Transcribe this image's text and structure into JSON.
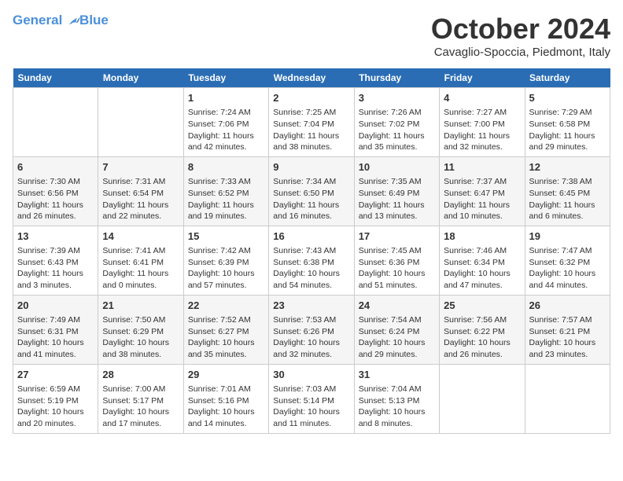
{
  "header": {
    "logo_line1": "General",
    "logo_line2": "Blue",
    "month": "October 2024",
    "location": "Cavaglio-Spoccia, Piedmont, Italy"
  },
  "weekdays": [
    "Sunday",
    "Monday",
    "Tuesday",
    "Wednesday",
    "Thursday",
    "Friday",
    "Saturday"
  ],
  "weeks": [
    [
      {
        "day": "",
        "info": ""
      },
      {
        "day": "",
        "info": ""
      },
      {
        "day": "1",
        "info": "Sunrise: 7:24 AM\nSunset: 7:06 PM\nDaylight: 11 hours and 42 minutes."
      },
      {
        "day": "2",
        "info": "Sunrise: 7:25 AM\nSunset: 7:04 PM\nDaylight: 11 hours and 38 minutes."
      },
      {
        "day": "3",
        "info": "Sunrise: 7:26 AM\nSunset: 7:02 PM\nDaylight: 11 hours and 35 minutes."
      },
      {
        "day": "4",
        "info": "Sunrise: 7:27 AM\nSunset: 7:00 PM\nDaylight: 11 hours and 32 minutes."
      },
      {
        "day": "5",
        "info": "Sunrise: 7:29 AM\nSunset: 6:58 PM\nDaylight: 11 hours and 29 minutes."
      }
    ],
    [
      {
        "day": "6",
        "info": "Sunrise: 7:30 AM\nSunset: 6:56 PM\nDaylight: 11 hours and 26 minutes."
      },
      {
        "day": "7",
        "info": "Sunrise: 7:31 AM\nSunset: 6:54 PM\nDaylight: 11 hours and 22 minutes."
      },
      {
        "day": "8",
        "info": "Sunrise: 7:33 AM\nSunset: 6:52 PM\nDaylight: 11 hours and 19 minutes."
      },
      {
        "day": "9",
        "info": "Sunrise: 7:34 AM\nSunset: 6:50 PM\nDaylight: 11 hours and 16 minutes."
      },
      {
        "day": "10",
        "info": "Sunrise: 7:35 AM\nSunset: 6:49 PM\nDaylight: 11 hours and 13 minutes."
      },
      {
        "day": "11",
        "info": "Sunrise: 7:37 AM\nSunset: 6:47 PM\nDaylight: 11 hours and 10 minutes."
      },
      {
        "day": "12",
        "info": "Sunrise: 7:38 AM\nSunset: 6:45 PM\nDaylight: 11 hours and 6 minutes."
      }
    ],
    [
      {
        "day": "13",
        "info": "Sunrise: 7:39 AM\nSunset: 6:43 PM\nDaylight: 11 hours and 3 minutes."
      },
      {
        "day": "14",
        "info": "Sunrise: 7:41 AM\nSunset: 6:41 PM\nDaylight: 11 hours and 0 minutes."
      },
      {
        "day": "15",
        "info": "Sunrise: 7:42 AM\nSunset: 6:39 PM\nDaylight: 10 hours and 57 minutes."
      },
      {
        "day": "16",
        "info": "Sunrise: 7:43 AM\nSunset: 6:38 PM\nDaylight: 10 hours and 54 minutes."
      },
      {
        "day": "17",
        "info": "Sunrise: 7:45 AM\nSunset: 6:36 PM\nDaylight: 10 hours and 51 minutes."
      },
      {
        "day": "18",
        "info": "Sunrise: 7:46 AM\nSunset: 6:34 PM\nDaylight: 10 hours and 47 minutes."
      },
      {
        "day": "19",
        "info": "Sunrise: 7:47 AM\nSunset: 6:32 PM\nDaylight: 10 hours and 44 minutes."
      }
    ],
    [
      {
        "day": "20",
        "info": "Sunrise: 7:49 AM\nSunset: 6:31 PM\nDaylight: 10 hours and 41 minutes."
      },
      {
        "day": "21",
        "info": "Sunrise: 7:50 AM\nSunset: 6:29 PM\nDaylight: 10 hours and 38 minutes."
      },
      {
        "day": "22",
        "info": "Sunrise: 7:52 AM\nSunset: 6:27 PM\nDaylight: 10 hours and 35 minutes."
      },
      {
        "day": "23",
        "info": "Sunrise: 7:53 AM\nSunset: 6:26 PM\nDaylight: 10 hours and 32 minutes."
      },
      {
        "day": "24",
        "info": "Sunrise: 7:54 AM\nSunset: 6:24 PM\nDaylight: 10 hours and 29 minutes."
      },
      {
        "day": "25",
        "info": "Sunrise: 7:56 AM\nSunset: 6:22 PM\nDaylight: 10 hours and 26 minutes."
      },
      {
        "day": "26",
        "info": "Sunrise: 7:57 AM\nSunset: 6:21 PM\nDaylight: 10 hours and 23 minutes."
      }
    ],
    [
      {
        "day": "27",
        "info": "Sunrise: 6:59 AM\nSunset: 5:19 PM\nDaylight: 10 hours and 20 minutes."
      },
      {
        "day": "28",
        "info": "Sunrise: 7:00 AM\nSunset: 5:17 PM\nDaylight: 10 hours and 17 minutes."
      },
      {
        "day": "29",
        "info": "Sunrise: 7:01 AM\nSunset: 5:16 PM\nDaylight: 10 hours and 14 minutes."
      },
      {
        "day": "30",
        "info": "Sunrise: 7:03 AM\nSunset: 5:14 PM\nDaylight: 10 hours and 11 minutes."
      },
      {
        "day": "31",
        "info": "Sunrise: 7:04 AM\nSunset: 5:13 PM\nDaylight: 10 hours and 8 minutes."
      },
      {
        "day": "",
        "info": ""
      },
      {
        "day": "",
        "info": ""
      }
    ]
  ]
}
